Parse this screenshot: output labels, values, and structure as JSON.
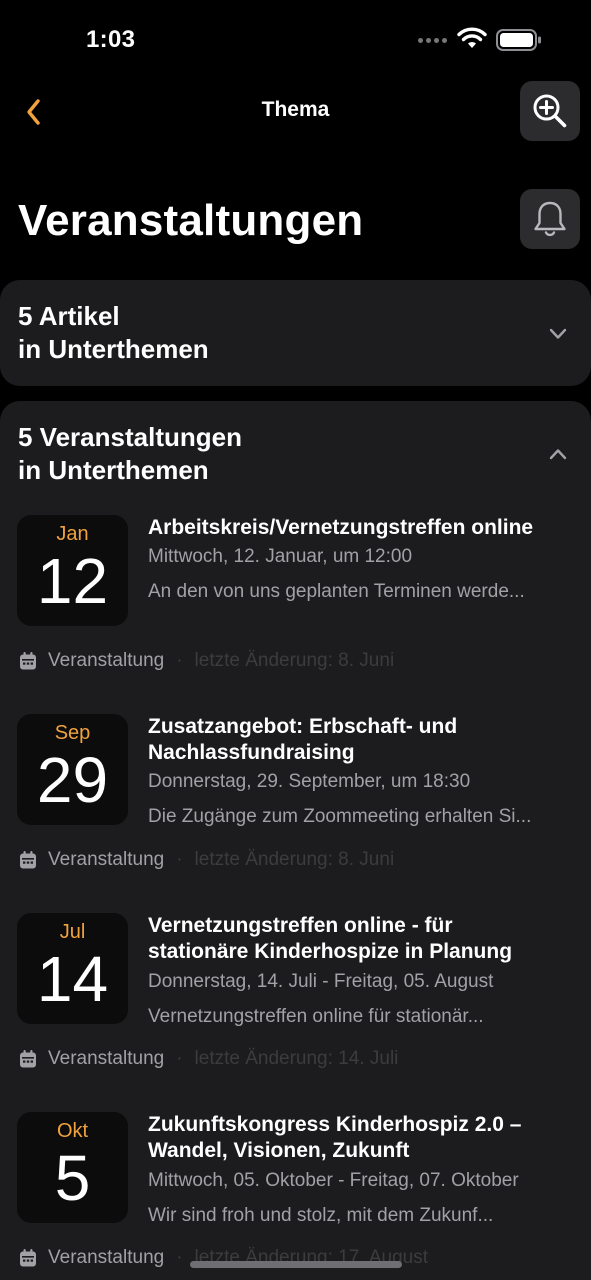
{
  "status_bar": {
    "time": "1:03"
  },
  "nav": {
    "title": "Thema",
    "back_icon": "chevron-left-icon",
    "zoom_icon": "zoom-in-icon",
    "bell_icon": "bell-icon"
  },
  "page": {
    "title": "Veranstaltungen"
  },
  "colors": {
    "accent": "#f0a23c",
    "card_bg": "#1c1c1e",
    "button_bg": "#2c2c2e",
    "secondary_text": "#a1a1a6"
  },
  "articles_section": {
    "line1": "5 Artikel",
    "line2": "in Unterthemen",
    "expanded": false
  },
  "events_section": {
    "line1": "5 Veranstaltungen",
    "line2": "in Unterthemen",
    "expanded": true,
    "events": [
      {
        "month": "Jan",
        "day": "12",
        "title": "Arbeitskreis/Vernetzungstreffen online",
        "when": "Mittwoch, 12. Januar, um 12:00",
        "description": "An den von uns geplanten Terminen werde...",
        "type": "Veranstaltung",
        "changed": "letzte Änderung: 8. Juni"
      },
      {
        "month": "Sep",
        "day": "29",
        "title": "Zusatzangebot: Erbschaft- und Nachlassfundraising",
        "when": "Donnerstag, 29. September, um 18:30",
        "description": "Die Zugänge zum Zoommeeting erhalten Si...",
        "type": "Veranstaltung",
        "changed": "letzte Änderung: 8. Juni"
      },
      {
        "month": "Jul",
        "day": "14",
        "title": "Vernetzungstreffen online - für stationäre Kinderhospize in Planung",
        "when": "Donnerstag, 14. Juli - Freitag, 05. August",
        "description": "Vernetzungstreffen online für stationär...",
        "type": "Veranstaltung",
        "changed": "letzte Änderung: 14. Juli"
      },
      {
        "month": "Okt",
        "day": "5",
        "title": "Zukunftskongress Kinderhospiz 2.0 – Wandel, Visionen, Zukunft",
        "when": "Mittwoch, 05. Oktober - Freitag, 07. Oktober",
        "description": "Wir sind froh und stolz, mit dem Zukunf...",
        "type": "Veranstaltung",
        "changed": "letzte Änderung: 17. August"
      }
    ]
  }
}
